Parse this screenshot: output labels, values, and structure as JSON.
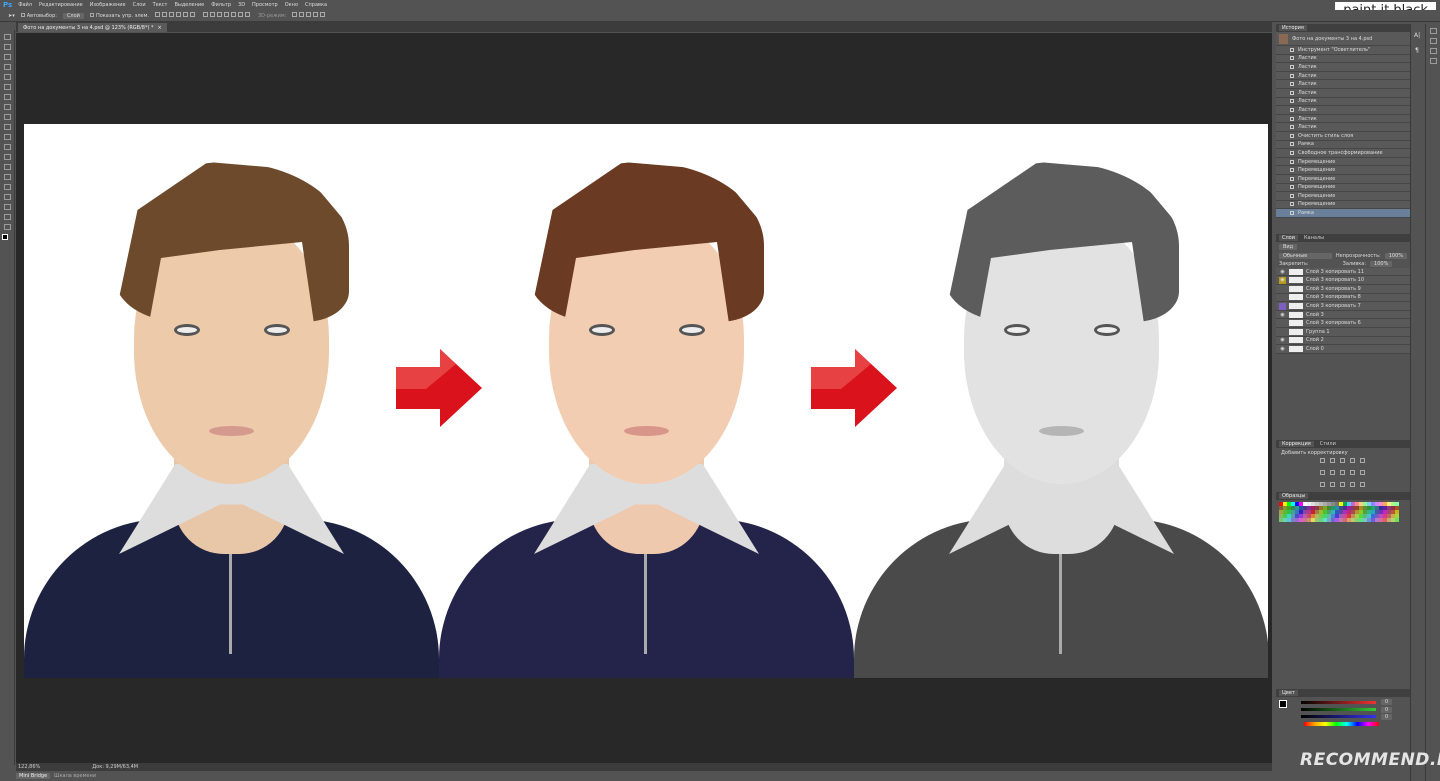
{
  "app": {
    "logo": "Ps"
  },
  "menu": [
    "Файл",
    "Редактирование",
    "Изображение",
    "Слои",
    "Текст",
    "Выделение",
    "Фильтр",
    "3D",
    "Просмотр",
    "Окно",
    "Справка"
  ],
  "options": {
    "autoselect": "Автовыбор:",
    "autoselect_value": "Слой",
    "show_controls": "Показать упр. элем.",
    "mode3d": "3D-режим:"
  },
  "document_tab": {
    "title": "Фото на документы 3 на 4.psd @ 123% (RGB/8*) *",
    "close": "×"
  },
  "status": {
    "zoom": "122,86%",
    "doc": "Док: 9,29M/63,4M"
  },
  "bottom_tabs": [
    "Mini Bridge",
    "Шкала времени"
  ],
  "history": {
    "tabs": [
      "История"
    ],
    "snapshot": "Фото на документы 3 на 4.psd",
    "items": [
      "Инструмент \"Осветлитель\"",
      "Ластик",
      "Ластик",
      "Ластик",
      "Ластик",
      "Ластик",
      "Ластик",
      "Ластик",
      "Ластик",
      "Ластик",
      "Очистить стиль слоя",
      "Рамка",
      "Свободное трансформирование",
      "Перемещение",
      "Перемещение",
      "Перемещение",
      "Перемещение",
      "Перемещение",
      "Перемещение",
      "Рамка"
    ],
    "selected_index": 19
  },
  "layers": {
    "tabs": [
      "Слои",
      "Каналы"
    ],
    "filter": "Вид",
    "blend_mode": "Обычные",
    "opacity_label": "Непрозрачность:",
    "opacity": "100%",
    "lock_label": "Закрепить:",
    "fill_label": "Заливка:",
    "fill": "100%",
    "items": [
      {
        "name": "Слой 3 копировать 11",
        "visible": true,
        "color": ""
      },
      {
        "name": "Слой 3 копировать 10",
        "visible": true,
        "color": "#b59a1c"
      },
      {
        "name": "Слой 3 копировать 9",
        "visible": false,
        "color": ""
      },
      {
        "name": "Слой 3 копировать 8",
        "visible": false,
        "color": ""
      },
      {
        "name": "Слой 3 копировать 7",
        "visible": false,
        "color": "#7c5fc0"
      },
      {
        "name": "Слой 3",
        "visible": true,
        "color": ""
      },
      {
        "name": "Слой 3 копировать 6",
        "visible": false,
        "color": ""
      },
      {
        "name": "Группа 1",
        "visible": false,
        "color": ""
      },
      {
        "name": "Слой 2",
        "visible": true,
        "color": ""
      },
      {
        "name": "Слой 0",
        "visible": true,
        "color": ""
      }
    ]
  },
  "adjustments": {
    "tabs": [
      "Коррекция",
      "Стили"
    ],
    "title": "Добавить корректировку"
  },
  "swatches": {
    "tabs": [
      "Образцы"
    ]
  },
  "color": {
    "tabs": [
      "Цвет"
    ],
    "r": "0",
    "g": "0",
    "b": "0"
  },
  "watermarks": {
    "top": ".paint.it.black.",
    "bottom": "RECOMMEND.RU"
  },
  "colors": {
    "accent_red": "#d9121b",
    "selection": "#6a7f9a",
    "canvas": "#282828",
    "panel": "#535353"
  }
}
